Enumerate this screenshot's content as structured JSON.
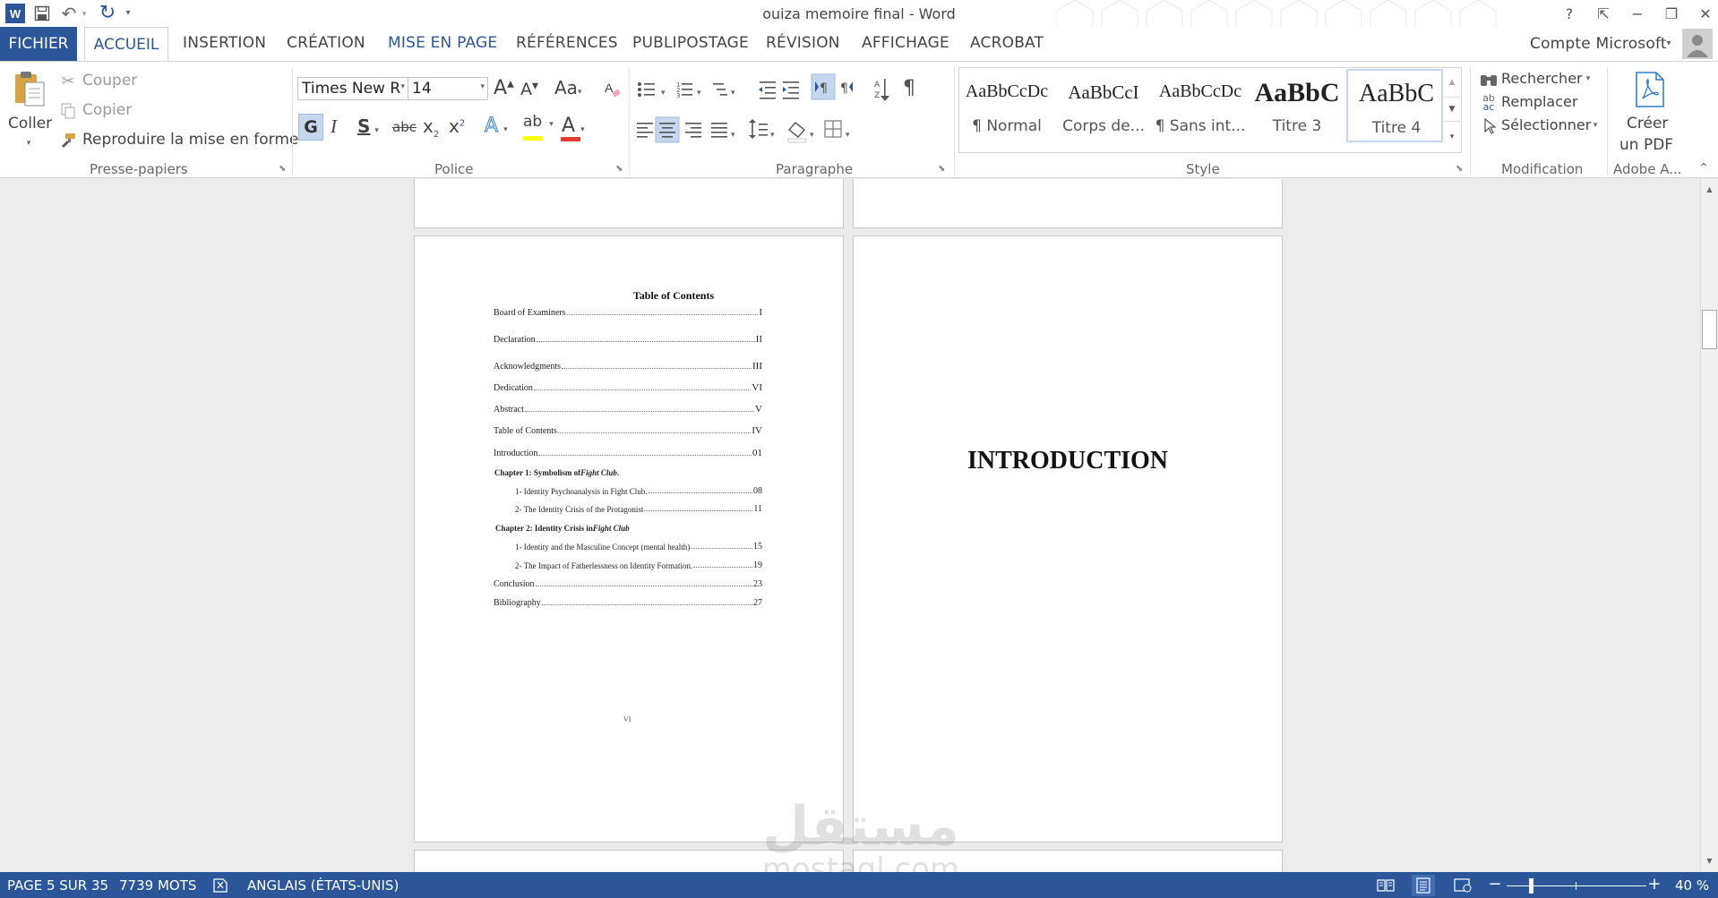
{
  "window": {
    "title": "ouiza memoire final - Word",
    "help": "?",
    "minimize": "−",
    "restore": "❐",
    "close": "✕",
    "ribbon_display": "⇱"
  },
  "tabs": {
    "file": "FICHIER",
    "home": "ACCUEIL",
    "items": [
      "INSERTION",
      "CRÉATION",
      "MISE EN PAGE",
      "RÉFÉRENCES",
      "PUBLIPOSTAGE",
      "RÉVISION",
      "AFFICHAGE",
      "ACROBAT"
    ],
    "account": "Compte Microsoft"
  },
  "clipboard": {
    "paste": "Coller",
    "cut": "Couper",
    "copy": "Copier",
    "format_painter": "Reproduire la mise en forme",
    "group": "Presse-papiers"
  },
  "font": {
    "name": "Times New R",
    "size": "14",
    "group": "Police",
    "bold": "G",
    "italic": "I",
    "underline": "S",
    "strike": "abc",
    "sub": "x",
    "sup": "x",
    "sub_mark": "2",
    "sup_mark": "2",
    "grow": "A",
    "shrink": "A",
    "case": "Aa",
    "effects": "A",
    "highlight": "ab",
    "font_color": "A"
  },
  "paragraph": {
    "group": "Paragraphe"
  },
  "styles": {
    "group": "Style",
    "items": [
      {
        "preview": "AaBbCcDc",
        "name": "¶ Normal"
      },
      {
        "preview": "AaBbCcI",
        "name": "Corps de..."
      },
      {
        "preview": "AaBbCcDc",
        "name": "¶ Sans int..."
      },
      {
        "preview": "AaBbC",
        "name": "Titre 3"
      },
      {
        "preview": "AaBbC",
        "name": "Titre 4"
      }
    ]
  },
  "editing": {
    "find": "Rechercher",
    "replace": "Remplacer",
    "select": "Sélectionner",
    "group": "Modification"
  },
  "adobe": {
    "create_line1": "Créer",
    "create_line2": "un PDF",
    "group": "Adobe A..."
  },
  "document": {
    "toc_title": "Table of Contents",
    "toc": [
      {
        "label": "Board of Examiners",
        "page": "I"
      },
      {
        "label": "Declaration",
        "page": "II"
      },
      {
        "label": "Acknowledgments",
        "page": "III"
      },
      {
        "label": "Dedication",
        "page": "VI"
      },
      {
        "label": "Abstract",
        "page": "V"
      },
      {
        "label": "Table of Contents",
        "page": "IV"
      },
      {
        "label": "Introduction",
        "page": "01"
      },
      {
        "label": "1- Identity Psychoanalysis in Fight Club.",
        "page": "08"
      },
      {
        "label": "2- The Identity Crisis of the Protagonist",
        "page": "11"
      },
      {
        "label": "1- Identity and the Masculine Concept (mental health)",
        "page": "15"
      },
      {
        "label": "2- The Impact of Fatherlessness on Identity Formation.",
        "page": "19"
      },
      {
        "label": "Conclusion",
        "page": "23"
      },
      {
        "label": "Bibliography",
        "page": "27"
      }
    ],
    "chapter1_prefix": "Chapter 1: Symbolism of ",
    "chapter1_italic": "Fight Club",
    "chapter1_suffix": ".",
    "chapter2_prefix": "Chapter 2: Identity Crisis in ",
    "chapter2_italic": "Fight Club",
    "page_footer": "VI",
    "right_page_heading": "INTRODUCTION"
  },
  "watermark": {
    "arabic": "مستقل",
    "latin": "mostaql.com"
  },
  "status": {
    "page": "PAGE 5 SUR 35",
    "words": "7739 MOTS",
    "language": "ANGLAIS (ÉTATS-UNIS)",
    "zoom": "40 %",
    "zoom_level_percent": 40
  },
  "colors": {
    "accent": "#2b579a",
    "highlight": "#ffff00",
    "font_color": "#e03c31"
  }
}
